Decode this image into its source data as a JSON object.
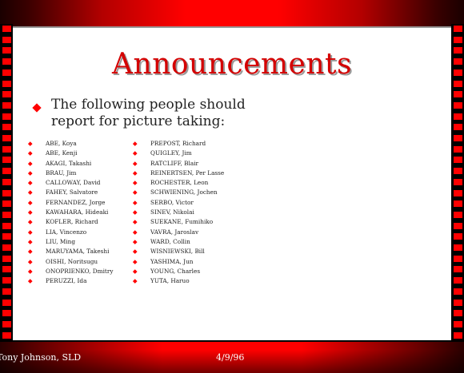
{
  "slide": {
    "title": "Announcements",
    "bullet": "The following people should report for picture taking:"
  },
  "names_left": [
    "ABE, Koya",
    "ABE, Kenji",
    "AKAGI, Takashi",
    "BRAU, Jim",
    "CALLOWAY, David",
    "FAHEY, Salvatore",
    "FERNANDEZ, Jorge",
    "KAWAHARA, Hideaki",
    "KOFLER, Richard",
    "LIA, Vincenzo",
    "LIU, Ming",
    "MARUYAMA, Takeshi",
    "OISHI, Noritsugu",
    "ONOPRIENKO, Dmitry",
    "PERUZZI, Ida"
  ],
  "names_right": [
    "PREPOST, Richard",
    "QUIGLEY, Jim",
    "RATCLIFF, Blair",
    "REINERTSEN, Per Lasse",
    "ROCHESTER, Leon",
    "SCHWIENING, Jochen",
    "SERBO, Victor",
    "SINEV, Nikolai",
    "SUEKANE, Fumihiko",
    "VAVRA, Jaroslav",
    "WARD, Collin",
    "WISNIEWSKI, Bill",
    "YASHIMA, Jun",
    "YOUNG, Charles",
    "YUTA, Haruo"
  ],
  "footer": {
    "author": "Tony Johnson, SLD",
    "date": "4/9/96"
  },
  "colors": {
    "accent": "#ff0000",
    "title": "#d40000",
    "background": "#ffffff",
    "frame": "#000000"
  }
}
